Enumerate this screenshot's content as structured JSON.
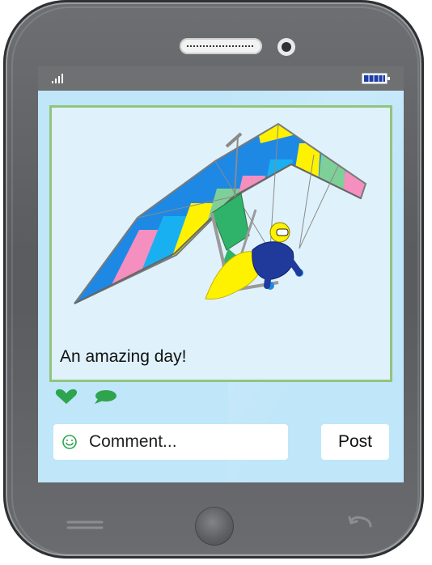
{
  "post": {
    "caption": "An amazing day!"
  },
  "comment": {
    "placeholder": "Comment...",
    "post_label": "Post"
  },
  "icons": {
    "signal": "signal-icon",
    "battery": "battery-icon",
    "like": "heart-icon",
    "comment": "comment-bubble-icon",
    "smiley": "smiley-icon",
    "menu": "menu-lines-icon",
    "back": "back-icon"
  },
  "colors": {
    "screen": "#bfe6f9",
    "accent": "#2ea44f",
    "card_border": "#93c47d",
    "battery": "#1e3ea8"
  }
}
